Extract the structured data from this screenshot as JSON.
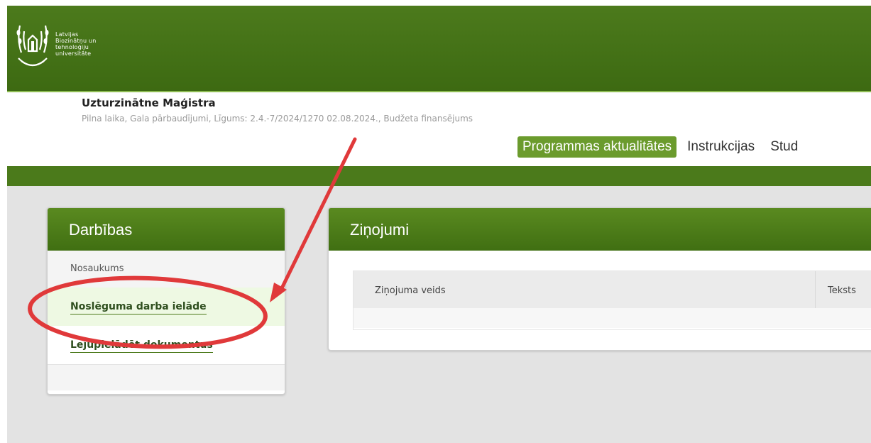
{
  "header": {
    "logo_lines": [
      "Latvijas",
      "Biozinātņu un",
      "tehnoloģiju",
      "universitāte"
    ]
  },
  "user": {
    "name": "Uzturzinātne Maģistra",
    "details": "Pilna laika, Gala pārbaudījumi, Līgums: 2.4.-7/2024/1270 02.08.2024., Budžeta finansējums"
  },
  "nav": {
    "items": [
      {
        "label": "Programmas aktualitātes",
        "active": true
      },
      {
        "label": "Instrukcijas",
        "active": false
      },
      {
        "label": "Stud",
        "active": false
      }
    ]
  },
  "actions_panel": {
    "title": "Darbības",
    "column_header": "Nosaukums",
    "items": [
      {
        "label": "Noslēguma darba ielāde",
        "highlighted": true
      },
      {
        "label": "Lejupielādēt dokumentus",
        "highlighted": false
      }
    ]
  },
  "messages_panel": {
    "title": "Ziņojumi",
    "columns": [
      "Ziņojuma veids",
      "Teksts"
    ]
  },
  "colors": {
    "brand_green": "#4c7a1c",
    "annotation_red": "#e0393a"
  }
}
